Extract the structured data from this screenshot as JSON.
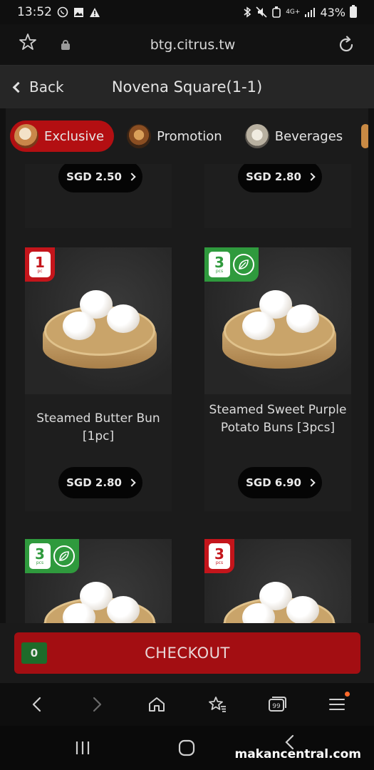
{
  "status_bar": {
    "time": "13:52",
    "network": "4G+",
    "battery": "43%"
  },
  "browser": {
    "url": "btg.citrus.tw"
  },
  "header": {
    "back_label": "Back",
    "title": "Novena Square(1-1)"
  },
  "tabs": [
    {
      "label": "Exclusive",
      "icon": "exclusive-icon",
      "active": true
    },
    {
      "label": "Promotion",
      "icon": "promotion-icon",
      "active": false
    },
    {
      "label": "Beverages",
      "icon": "beverages-icon",
      "active": false
    }
  ],
  "products": {
    "partial_row": [
      {
        "price": "SGD 2.50"
      },
      {
        "price": "SGD 2.80"
      }
    ],
    "row2": [
      {
        "name": "Steamed Butter Bun [1pc]",
        "price": "SGD 2.80",
        "badge_count": "1",
        "badge_unit": "pc",
        "badge_color": "#c4151b",
        "vegetarian": false
      },
      {
        "name": "Steamed Sweet Purple Potato Buns [3pcs]",
        "price": "SGD 6.90",
        "badge_count": "3",
        "badge_unit": "pcs",
        "badge_color": "#2f9a3d",
        "vegetarian": true
      }
    ],
    "row3": [
      {
        "badge_count": "3",
        "badge_unit": "pcs",
        "badge_color": "#2f9a3d",
        "vegetarian": true
      },
      {
        "badge_count": "3",
        "badge_unit": "pcs",
        "badge_color": "#c4151b",
        "vegetarian": false
      }
    ]
  },
  "checkout": {
    "cart_count": "0",
    "label": "CHECKOUT"
  },
  "watermark": "makancentral.com",
  "colors": {
    "accent_red": "#b30f12",
    "checkout_red": "#a30e12",
    "veg_green": "#2f9a3d",
    "cart_green": "#1e6b2a"
  }
}
